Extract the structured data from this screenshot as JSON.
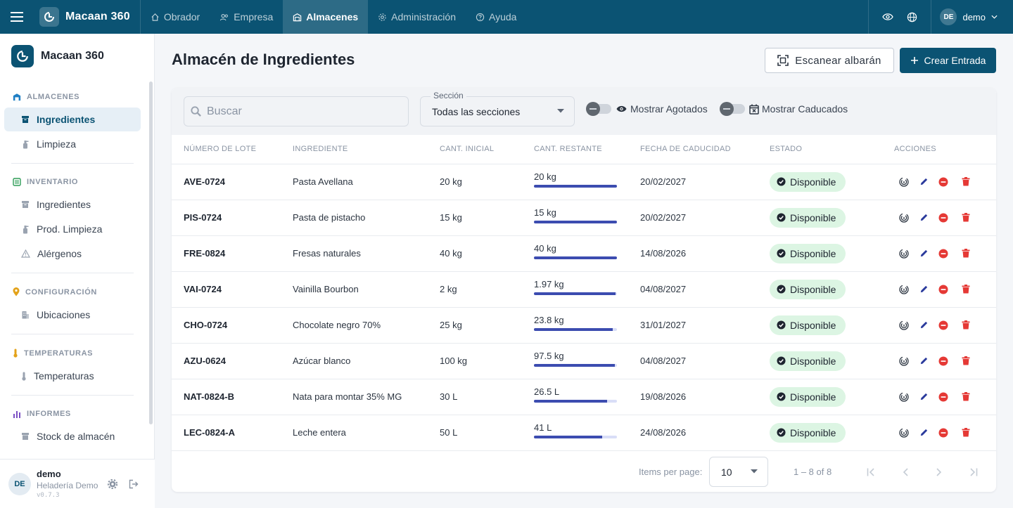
{
  "topbar": {
    "brand": "Macaan 360",
    "nav": [
      {
        "label": "Obrador",
        "icon": "home-icon",
        "active": false
      },
      {
        "label": "Empresa",
        "icon": "people-icon",
        "active": false
      },
      {
        "label": "Almacenes",
        "icon": "warehouse-icon",
        "active": true
      },
      {
        "label": "Administración",
        "icon": "gear-icon",
        "active": false
      },
      {
        "label": "Ayuda",
        "icon": "help-icon",
        "active": false
      }
    ],
    "user_initials": "DE",
    "user_name": "demo",
    "accent": "#0b5373"
  },
  "sidebar": {
    "brand": "Macaan 360",
    "sections": [
      {
        "title": "ALMACENES",
        "icon": "warehouse-icon",
        "icon_color": "#1f7fc4",
        "items": [
          {
            "label": "Ingredientes",
            "active": true,
            "icon": "bin-icon"
          },
          {
            "label": "Limpieza",
            "active": false,
            "icon": "spray-icon"
          }
        ]
      },
      {
        "title": "INVENTARIO",
        "icon": "inventory-icon",
        "icon_color": "#2e9c57",
        "items": [
          {
            "label": "Ingredientes",
            "icon": "bin-icon"
          },
          {
            "label": "Prod. Limpieza",
            "icon": "spray-icon"
          },
          {
            "label": "Alérgenos",
            "icon": "warning-icon"
          }
        ]
      },
      {
        "title": "CONFIGURACIÓN",
        "icon": "location-pin-icon",
        "icon_color": "#e3a21a",
        "items": [
          {
            "label": "Ubicaciones",
            "icon": "building-icon"
          }
        ]
      },
      {
        "title": "TEMPERATURAS",
        "icon": "thermometer-icon",
        "icon_color": "#e3a21a",
        "items": [
          {
            "label": "Temperaturas",
            "icon": "thermometer-icon"
          }
        ]
      },
      {
        "title": "INFORMES",
        "icon": "bar-chart-icon",
        "icon_color": "#7b4fc4",
        "items": [
          {
            "label": "Stock de almacén",
            "icon": "bin-icon"
          }
        ]
      }
    ],
    "footer": {
      "initials": "DE",
      "name": "demo",
      "org": "Heladería Demo",
      "version": "v0.7.3"
    }
  },
  "main": {
    "title": "Almacén de Ingredientes",
    "scan_button": "Escanear albarán",
    "create_button": "Crear Entrada",
    "filters": {
      "search_placeholder": "Buscar",
      "section_label": "Sección",
      "section_value": "Todas las secciones",
      "toggle_out_of_stock": "Mostrar Agotados",
      "toggle_expired": "Mostrar Caducados"
    },
    "table": {
      "columns": [
        "NÚMERO DE LOTE",
        "INGREDIENTE",
        "CANT. INICIAL",
        "CANT. RESTANTE",
        "FECHA DE CADUCIDAD",
        "ESTADO",
        "ACCIONES"
      ],
      "rows": [
        {
          "lot": "AVE-0724",
          "ingredient": "Pasta Avellana",
          "initial": "20 kg",
          "remaining": "20 kg",
          "remaining_pct": 100,
          "expiry": "20/02/2027",
          "status": "Disponible"
        },
        {
          "lot": "PIS-0724",
          "ingredient": "Pasta de pistacho",
          "initial": "15 kg",
          "remaining": "15 kg",
          "remaining_pct": 100,
          "expiry": "20/02/2027",
          "status": "Disponible"
        },
        {
          "lot": "FRE-0824",
          "ingredient": "Fresas naturales",
          "initial": "40 kg",
          "remaining": "40 kg",
          "remaining_pct": 100,
          "expiry": "14/08/2026",
          "status": "Disponible"
        },
        {
          "lot": "VAI-0724",
          "ingredient": "Vainilla Bourbon",
          "initial": "2 kg",
          "remaining": "1.97 kg",
          "remaining_pct": 98.5,
          "expiry": "04/08/2027",
          "status": "Disponible"
        },
        {
          "lot": "CHO-0724",
          "ingredient": "Chocolate negro 70%",
          "initial": "25 kg",
          "remaining": "23.8 kg",
          "remaining_pct": 95.2,
          "expiry": "31/01/2027",
          "status": "Disponible"
        },
        {
          "lot": "AZU-0624",
          "ingredient": "Azúcar blanco",
          "initial": "100 kg",
          "remaining": "97.5 kg",
          "remaining_pct": 97.5,
          "expiry": "04/08/2027",
          "status": "Disponible"
        },
        {
          "lot": "NAT-0824-B",
          "ingredient": "Nata para montar 35% MG",
          "initial": "30 L",
          "remaining": "26.5 L",
          "remaining_pct": 88.3,
          "expiry": "19/08/2026",
          "status": "Disponible"
        },
        {
          "lot": "LEC-0824-A",
          "ingredient": "Leche entera",
          "initial": "50 L",
          "remaining": "41 L",
          "remaining_pct": 82,
          "expiry": "24/08/2026",
          "status": "Disponible"
        }
      ]
    },
    "pager": {
      "items_label": "Items per page:",
      "page_size": "10",
      "range": "1 – 8 of 8"
    },
    "colors": {
      "status_bg": "#dcf5e3",
      "status_icon": "#1e2530",
      "bar": "#3c4cb0",
      "delete": "#e53935",
      "edit": "#2a3a9c"
    }
  }
}
